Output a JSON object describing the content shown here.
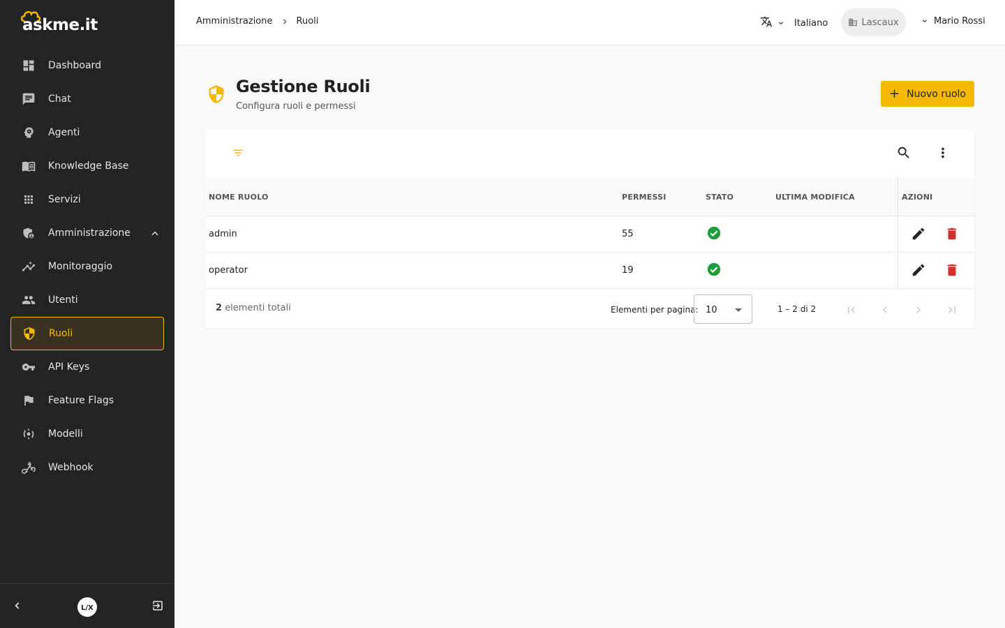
{
  "app": {
    "logo_text": "askme.it"
  },
  "sidebar": {
    "items": [
      {
        "label": "Dashboard",
        "icon": "dashboard-icon"
      },
      {
        "label": "Chat",
        "icon": "chat-icon"
      },
      {
        "label": "Agenti",
        "icon": "agent-icon"
      },
      {
        "label": "Knowledge Base",
        "icon": "book-icon"
      },
      {
        "label": "Servizi",
        "icon": "apps-grid-icon"
      },
      {
        "label": "Amministrazione",
        "icon": "admin-shield-icon"
      },
      {
        "label": "Monitoraggio",
        "icon": "analytics-icon"
      },
      {
        "label": "Utenti",
        "icon": "people-icon"
      },
      {
        "label": "Ruoli",
        "icon": "shield-icon"
      },
      {
        "label": "API Keys",
        "icon": "key-icon"
      },
      {
        "label": "Feature Flags",
        "icon": "flag-icon"
      },
      {
        "label": "Modelli",
        "icon": "model-icon"
      },
      {
        "label": "Webhook",
        "icon": "webhook-icon"
      }
    ],
    "active": "Ruoli",
    "accent": "#f5b800"
  },
  "header": {
    "breadcrumb": [
      "Amministrazione",
      "Ruoli"
    ],
    "language": "Italiano",
    "tenant": "Lascaux",
    "user": "Mario Rossi"
  },
  "page": {
    "title": "Gestione Ruoli",
    "subtitle": "Configura ruoli e permessi",
    "new_button": "Nuovo ruolo"
  },
  "table": {
    "columns": [
      "NOME RUOLO",
      "PERMESSI",
      "STATO",
      "ULTIMA MODIFICA",
      "AZIONI"
    ],
    "rows": [
      {
        "name": "admin",
        "permissions": "55",
        "status": "active",
        "last_modified": ""
      },
      {
        "name": "operator",
        "permissions": "19",
        "status": "active",
        "last_modified": ""
      }
    ],
    "total_count": "2",
    "total_suffix": "elementi totali",
    "per_page_label": "Elementi per pagina:",
    "per_page_value": "10",
    "range": "1 – 2 di 2"
  },
  "colors": {
    "status_ok": "#1e9e3a",
    "delete": "#d32f2f",
    "accent": "#f5b800"
  }
}
